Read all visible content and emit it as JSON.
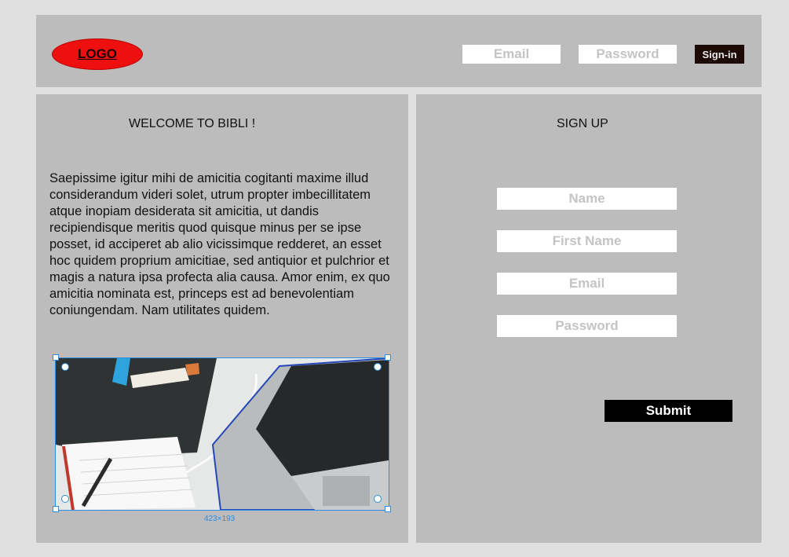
{
  "header": {
    "logo_text": "LOGO",
    "email_placeholder": "Email",
    "password_placeholder": "Password",
    "signin_label": "Sign-in"
  },
  "welcome": {
    "title": "WELCOME TO BIBLI !",
    "body": "Saepissime igitur mihi de amicitia cogitanti maxime illud considerandum videri solet, utrum propter imbecillitatem atque inopiam desiderata sit amicitia, ut dandis recipiendisque meritis quod quisque minus per se ipse posset, id acciperet ab alio vicissimque redderet, an esset hoc quidem proprium amicitiae, sed antiquior et pulchrior et magis a natura ipsa profecta alia causa. Amor enim, ex quo amicitia nominata est, princeps est ad benevolentiam coniungendam. Nam utilitates quidem.",
    "image_size_label": "423×193"
  },
  "signup": {
    "title": "SIGN UP",
    "name_placeholder": "Name",
    "first_name_placeholder": "First Name",
    "email_placeholder": "Email",
    "password_placeholder": "Password",
    "submit_label": "Submit"
  },
  "colors": {
    "page_bg": "#e0e0e0",
    "panel_bg": "#bcbcbc",
    "logo_red": "#ee0f0f",
    "selection_blue": "#2b8de4",
    "submit_bg": "#000000"
  }
}
